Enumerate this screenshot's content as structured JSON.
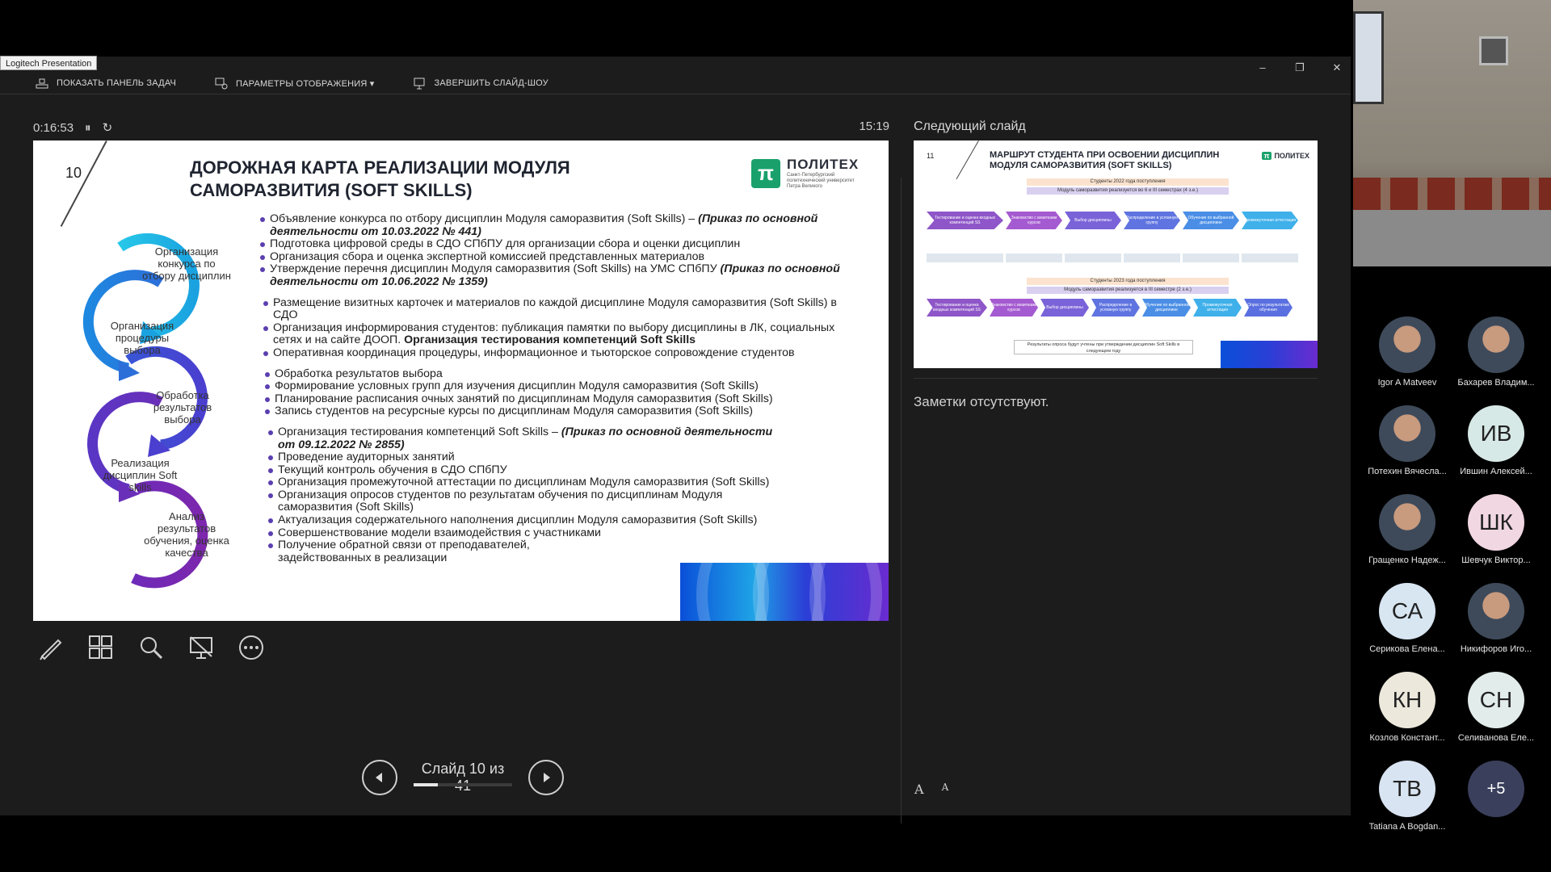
{
  "app_badge": "Logitech Presentation",
  "toolbar": {
    "taskbar": "ПОКАЗАТЬ ПАНЕЛЬ ЗАДАЧ",
    "display": "ПАРАМЕТРЫ ОТОБРАЖЕНИЯ ▾",
    "end_show": "ЗАВЕРШИТЬ СЛАЙД-ШОУ"
  },
  "timer": {
    "elapsed": "0:16:53",
    "clock": "15:19"
  },
  "next_slide_label": "Следующий слайд",
  "slide": {
    "number": "10",
    "title": "ДОРОЖНАЯ КАРТА РЕАЛИЗАЦИИ МОДУЛЯ САМОРАЗВИТИЯ (SOFT SKILLS)",
    "logo_name": "ПОЛИТЕХ",
    "logo_sub": "Санкт-Петербургский политехнический университет Петра Великого",
    "cycle": [
      "Организация конкурса по отбору дисциплин",
      "Организация процедуры выбора",
      "Обработка результатов выбора",
      "Реализация дисциплин Soft skills",
      "Анализ результатов обучения, оценка качества"
    ],
    "g1": [
      "Объявление конкурса по отбору дисциплин Модуля саморазвития (Soft Skills) – ",
      "(Приказ по основной деятельности от 10.03.2022 № 441)",
      "Подготовка цифровой среды в СДО СПбПУ для организации сбора и оценки дисциплин",
      "Организация сбора и оценка экспертной комиссией  представленных материалов",
      "Утверждение перечня дисциплин Модуля саморазвития (Soft Skills) на УМС СПбПУ ",
      "(Приказ по основной деятельности от 10.06.2022 № 1359)"
    ],
    "g2": [
      "Размещение визитных карточек и материалов по каждой дисциплине Модуля саморазвития (Soft Skills) в СДО",
      "Организация информирования студентов: публикация памятки по выбору дисциплины в ЛК, социальных сетях и на сайте ДООП. ",
      "Организация тестирования компетенций Soft Skills",
      "Оперативная координация процедуры, информационное и тьюторское сопровождение студентов"
    ],
    "g3": [
      "Обработка результатов выбора",
      "Формирование условных групп для изучения дисциплин Модуля саморазвития (Soft Skills)",
      "Планирование расписания очных занятий по дисциплинам Модуля саморазвития (Soft Skills)",
      "Запись студентов на ресурсные курсы по дисциплинам Модуля саморазвития (Soft Skills)"
    ],
    "g4": [
      "Организация тестирования компетенций Soft Skills – ",
      "(Приказ по основной деятельности от 09.12.2022 № 2855)",
      "Проведение аудиторных занятий",
      "Текущий контроль обучения в СДО СПбПУ",
      "Организация промежуточной аттестации по дисциплинам Модуля саморазвития (Soft Skills)",
      "Организация опросов студентов по результатам обучения по дисциплинам Модуля саморазвития (Soft Skills)",
      "Актуализация содержательного наполнения дисциплин Модуля саморазвития (Soft Skills)",
      "Совершенствование модели взаимодействия с участниками",
      "Получение обратной связи от преподавателей, задействованных в реализации"
    ]
  },
  "next_slide": {
    "number": "11",
    "title": "МАРШРУТ СТУДЕНТА ПРИ ОСВОЕНИИ ДИСЦИПЛИН МОДУЛЯ САМОРАЗВИТИЯ (SOFT SKILLS)",
    "logo": "ПОЛИТЕХ",
    "bar1": "Студенты 2022 года поступления",
    "bar1b": "Модуль саморазвития реализуется во 6 и III семестрах (4 з.е.)",
    "bar2": "Студенты 2023 года поступления",
    "bar2b": "Модуль саморазвития реализуется в III семестре (2 з.е.)",
    "row1": [
      "Тестирование и оценка входных компетенций SS",
      "Знакомство с визитками курсов",
      "Выбор дисциплины",
      "Распределение в условную группу",
      "Обучение по выбранной дисциплине",
      "Промежуточная аттестация"
    ],
    "row2": [
      "Тестирование и оценка входных компетенций SS",
      "Знакомство с визитками курсов",
      "Выбор дисциплины",
      "Распределение в условную группу",
      "Обучение по выбранной дисциплине",
      "Промежуточная аттестация",
      "Опрос по результатам обучения"
    ],
    "note": "Результаты опроса будут учтены при утверждении дисциплин Soft Skills в следующем году"
  },
  "navigation": {
    "counter": "Слайд 10 из 41",
    "progress": 0.244
  },
  "notes": "Заметки отсутствуют.",
  "font_buttons": [
    "A",
    "A"
  ],
  "participants": [
    {
      "name": "Igor A Matveev",
      "initials": "",
      "photo": true,
      "color": ""
    },
    {
      "name": "Бахарев Владим...",
      "initials": "",
      "photo": true,
      "color": ""
    },
    {
      "name": "Потехин Вячесла...",
      "initials": "",
      "photo": true,
      "color": ""
    },
    {
      "name": "Ившин Алексей...",
      "initials": "ИВ",
      "photo": false,
      "color": "#d7e9e6"
    },
    {
      "name": "Гращенко Надеж...",
      "initials": "",
      "photo": true,
      "color": ""
    },
    {
      "name": "Шевчук Виктор...",
      "initials": "ШК",
      "photo": false,
      "color": "#f1d7e2"
    },
    {
      "name": "Серикова Елена...",
      "initials": "СА",
      "photo": false,
      "color": "#d8e6f2"
    },
    {
      "name": "Никифоров Иго...",
      "initials": "",
      "photo": true,
      "color": ""
    },
    {
      "name": "Козлов Констант...",
      "initials": "КН",
      "photo": false,
      "color": "#ece8dc"
    },
    {
      "name": "Селиванова Еле...",
      "initials": "СН",
      "photo": false,
      "color": "#e2ecea"
    },
    {
      "name": "Tatiana A Bogdan...",
      "initials": "ТВ",
      "photo": false,
      "color": "#d9e4f2"
    },
    {
      "name": "",
      "initials": "+5",
      "photo": false,
      "color": "#3a3f5c"
    }
  ],
  "colors": {
    "accent_purple": "#5b3fb0",
    "logo_green": "#1aa16b"
  }
}
